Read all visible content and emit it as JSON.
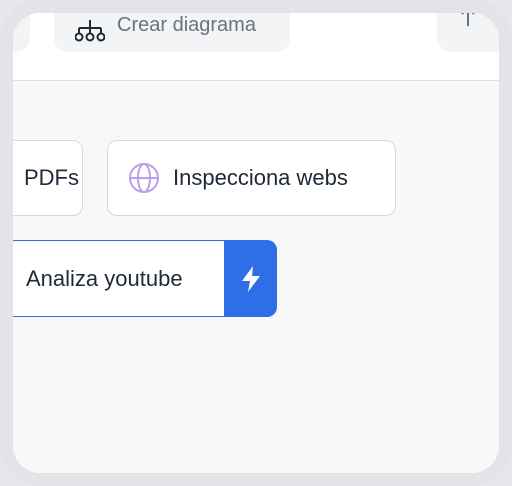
{
  "toolbar": {
    "create_diagram_label": "Crear diagrama"
  },
  "chips": {
    "pdfs_label": "PDFs",
    "inspect_webs_label": "Inspecciona webs",
    "analyze_youtube_label": "Analiza youtube"
  },
  "icons": {
    "diagram": "diagram-icon",
    "globe": "globe-icon",
    "bolt": "bolt-icon",
    "share": "share-icon"
  },
  "colors": {
    "accent": "#2e6ee6",
    "globe": "#b9a0ee",
    "chip_border": "#d9d9dc",
    "background": "#f8f8f8"
  }
}
